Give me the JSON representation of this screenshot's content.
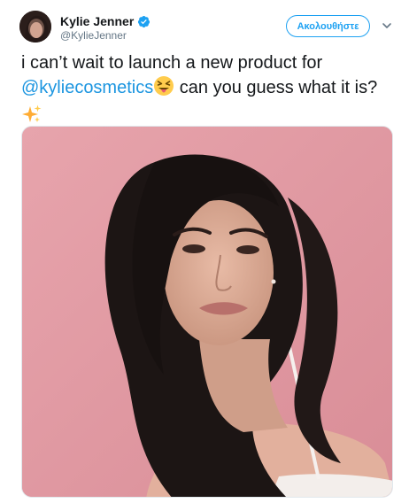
{
  "header": {
    "display_name": "Kylie Jenner",
    "handle": "@KylieJenner",
    "follow_label": "Ακολουθήστε"
  },
  "tweet": {
    "text_before": "i can’t wait to launch a new product for ",
    "mention": "@kyliecosmetics",
    "text_after": " can you guess what it is?",
    "emoji_1": "squinting-face-with-tongue",
    "emoji_2": "sparkles"
  },
  "icons": {
    "verified": "verified-badge-icon",
    "caret": "chevron-down-icon"
  },
  "colors": {
    "accent": "#1da1f2",
    "mention": "#1b95e0",
    "text": "#14171a",
    "muted": "#657786",
    "media_background": "#e29aa3"
  }
}
